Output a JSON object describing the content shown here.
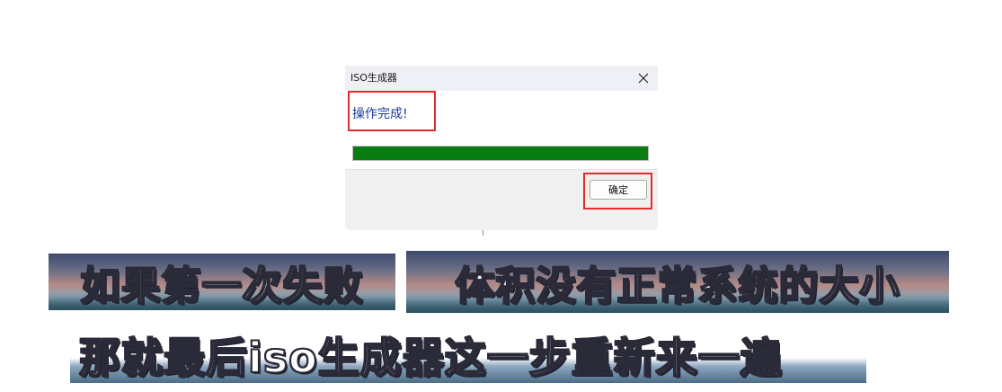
{
  "dialog": {
    "title": "ISO生成器",
    "message": "操作完成!",
    "progress_percent": 100,
    "ok_label": "确定"
  },
  "subtitles": {
    "line1_left": "如果第一次失败",
    "line1_right": "体积没有正常系统的大小",
    "line2": "那就最后iso生成器这一步重新来一遍"
  },
  "colors": {
    "highlight": "#e32b2b",
    "progress": "#0a7d12",
    "message_text": "#1d3d9e"
  },
  "icons": {
    "close": "close-icon"
  }
}
